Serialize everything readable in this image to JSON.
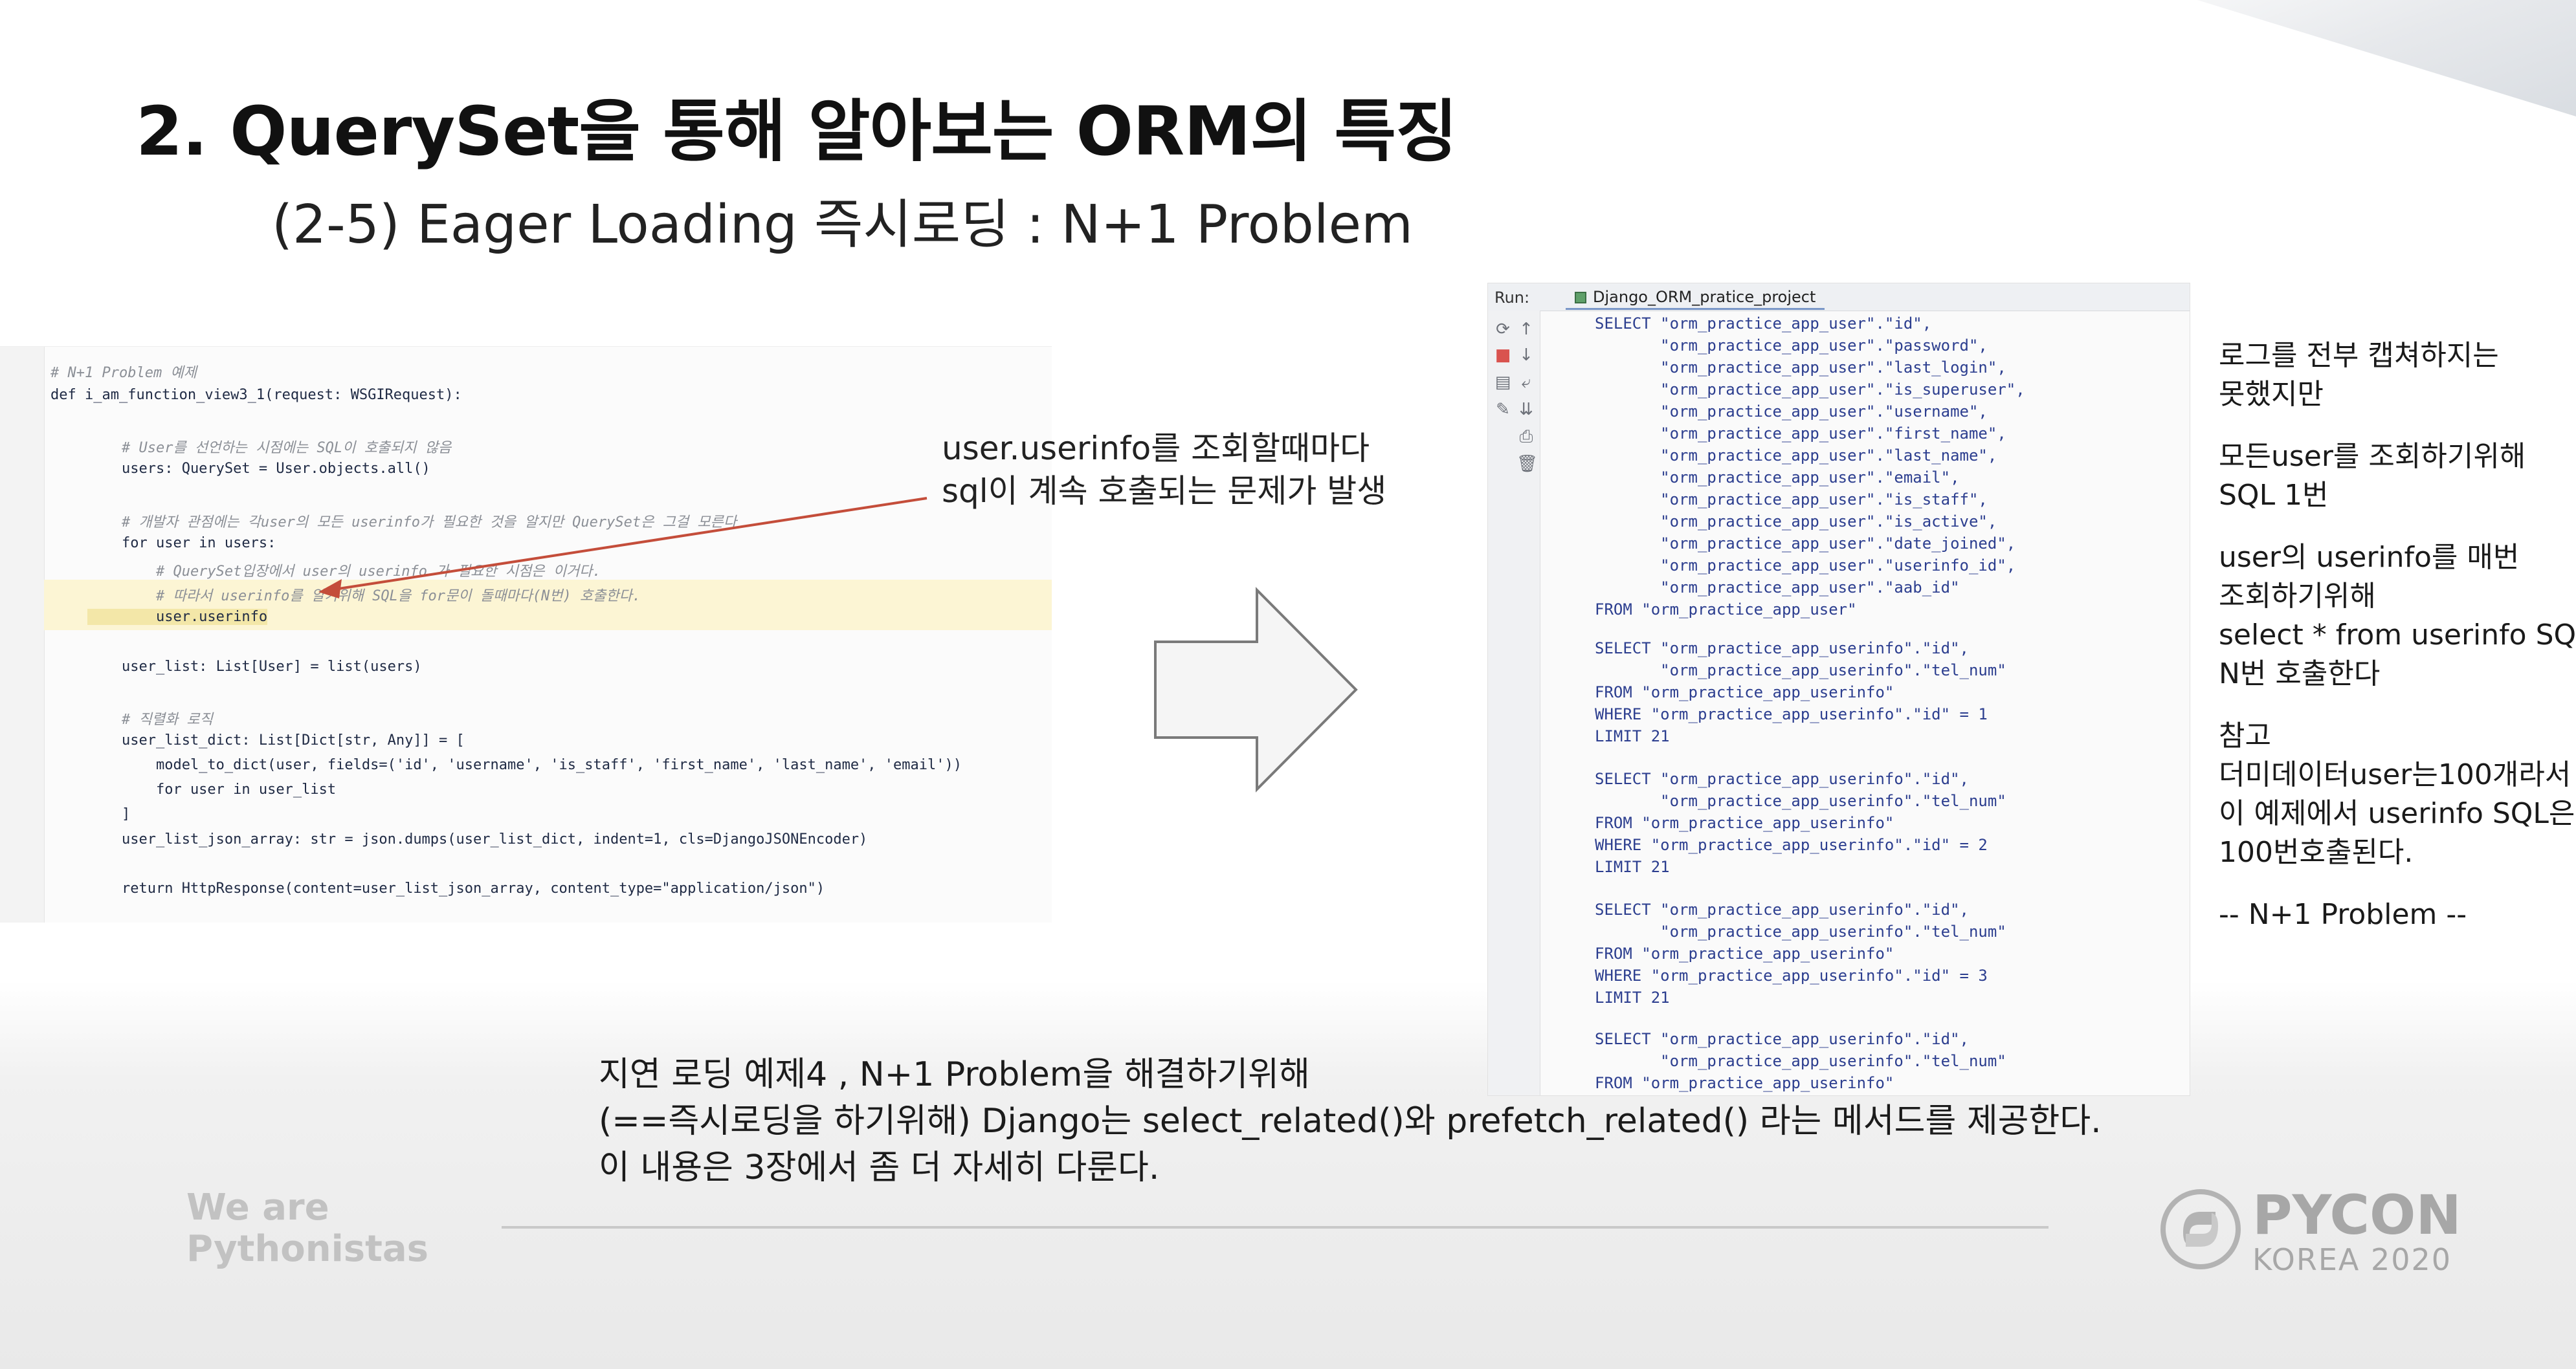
{
  "slide": {
    "title": "2. QuerySet을 통해 알아보는 ORM의 특징",
    "subtitle": "(2-5) Eager Loading 즉시로딩 : N+1 Problem"
  },
  "code": {
    "lines": [
      "# N+1 Problem 예제",
      "def i_am_function_view3_1(request: WSGIRequest):",
      "    # User를 선언하는 시점에는 SQL이 호출되지 않음",
      "    users: QuerySet = User.objects.all()",
      "    # 개발자 관점에는 각user의 모든 userinfo가 필요한 것을 알지만 QuerySet은 그걸 모른다",
      "    for user in users:",
      "        # QuerySet입장에서 user의 userinfo 가 필요한 시점은 이거다.",
      "        # 따라서 userinfo를 알기위해 SQL을 for문이 돌때마다(N번) 호출한다.",
      "        user.userinfo",
      "    user_list: List[User] = list(users)",
      "    # 직렬화 로직",
      "    user_list_dict: List[Dict[str, Any]] = [",
      "        model_to_dict(user, fields=('id', 'username', 'is_staff', 'first_name', 'last_name', 'email'))",
      "        for user in user_list",
      "    ]",
      "    user_list_json_array: str = json.dumps(user_list_dict, indent=1, cls=DjangoJSONEncoder)",
      "    return HttpResponse(content=user_list_json_array, content_type=\"application/json\")"
    ]
  },
  "annotation": {
    "line1": "user.userinfo를 조회할때마다",
    "line2": "sql이 계속 호출되는 문제가 발생"
  },
  "console": {
    "run_label": "Run:",
    "tab_label": "Django_ORM_pratice_project",
    "lines": [
      "SELECT \"orm_practice_app_user\".\"id\",",
      "       \"orm_practice_app_user\".\"password\",",
      "       \"orm_practice_app_user\".\"last_login\",",
      "       \"orm_practice_app_user\".\"is_superuser\",",
      "       \"orm_practice_app_user\".\"username\",",
      "       \"orm_practice_app_user\".\"first_name\",",
      "       \"orm_practice_app_user\".\"last_name\",",
      "       \"orm_practice_app_user\".\"email\",",
      "       \"orm_practice_app_user\".\"is_staff\",",
      "       \"orm_practice_app_user\".\"is_active\",",
      "       \"orm_practice_app_user\".\"date_joined\",",
      "       \"orm_practice_app_user\".\"userinfo_id\",",
      "       \"orm_practice_app_user\".\"aab_id\"",
      "FROM \"orm_practice_app_user\"",
      "SELECT \"orm_practice_app_userinfo\".\"id\",",
      "       \"orm_practice_app_userinfo\".\"tel_num\"",
      "FROM \"orm_practice_app_userinfo\"",
      "WHERE \"orm_practice_app_userinfo\".\"id\" = 1",
      "LIMIT 21",
      "SELECT \"orm_practice_app_userinfo\".\"id\",",
      "       \"orm_practice_app_userinfo\".\"tel_num\"",
      "FROM \"orm_practice_app_userinfo\"",
      "WHERE \"orm_practice_app_userinfo\".\"id\" = 2",
      "LIMIT 21",
      "SELECT \"orm_practice_app_userinfo\".\"id\",",
      "       \"orm_practice_app_userinfo\".\"tel_num\"",
      "FROM \"orm_practice_app_userinfo\"",
      "WHERE \"orm_practice_app_userinfo\".\"id\" = 3",
      "LIMIT 21",
      "SELECT \"orm_practice_app_userinfo\".\"id\",",
      "       \"orm_practice_app_userinfo\".\"tel_num\"",
      "FROM \"orm_practice_app_userinfo\""
    ]
  },
  "notes": {
    "block1": [
      "로그를 전부 캡쳐하지는",
      "못했지만"
    ],
    "block2": [
      "모든user를 조회하기위해",
      "SQL 1번"
    ],
    "block3": [
      "user의 userinfo를 매번",
      "조회하기위해",
      "select * from userinfo SQL",
      "N번 호출한다"
    ],
    "block4": [
      " 참고",
      "더미데이터user는100개라서",
      "이 예제에서 userinfo SQL은",
      "100번호출된다."
    ],
    "block5": [
      "-- N+1 Problem --"
    ]
  },
  "caption": {
    "line1": "지연 로딩 예제4  , N+1 Problem을 해결하기위해",
    "line2": "(==즉시로딩을 하기위해) Django는 select_related()와 prefetch_related() 라는 메서드를 제공한다.",
    "line3": "이 내용은 3장에서 좀 더 자세히 다룬다."
  },
  "footer": {
    "tagline_line1": "We are",
    "tagline_line2": "Pythonistas",
    "brand": "PYCON",
    "brand_sub": "KOREA 2020"
  }
}
